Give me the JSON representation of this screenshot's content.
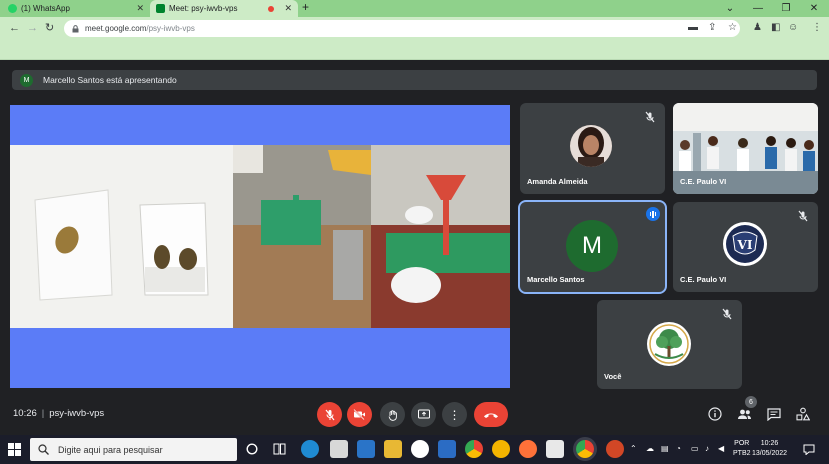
{
  "browser": {
    "tabs": [
      {
        "title": "(1) WhatsApp",
        "active": false
      },
      {
        "title": "Meet: psy-iwvb-vps",
        "active": true
      }
    ],
    "url_domain": "meet.google.com",
    "url_path": "/psy-iwvb-vps"
  },
  "meet": {
    "presenter_initial": "M",
    "presenter_banner": "Marcello Santos está apresentando",
    "meeting_time": "10:26",
    "meeting_code": "psy-iwvb-vps",
    "participants_count": "6",
    "tiles": [
      {
        "name": "Amanda Almeida",
        "muted": true
      },
      {
        "name": "C.E. Paulo VI",
        "muted": false
      },
      {
        "name": "Marcello Santos",
        "initial": "M",
        "speaking": true
      },
      {
        "name": "C.E. Paulo VI",
        "muted": true,
        "logo_text": "VI"
      },
      {
        "name": "Você",
        "muted": true
      }
    ],
    "colors": {
      "accent": "#1a73e8",
      "hangup": "#ea4335",
      "avatar_green": "#1e6b2f",
      "screen_bg": "#5b7cf7"
    }
  },
  "taskbar": {
    "search_placeholder": "Digite aqui para pesquisar",
    "lang_line1": "POR",
    "lang_line2": "PTB2",
    "time": "10:26",
    "date": "13/05/2022"
  }
}
